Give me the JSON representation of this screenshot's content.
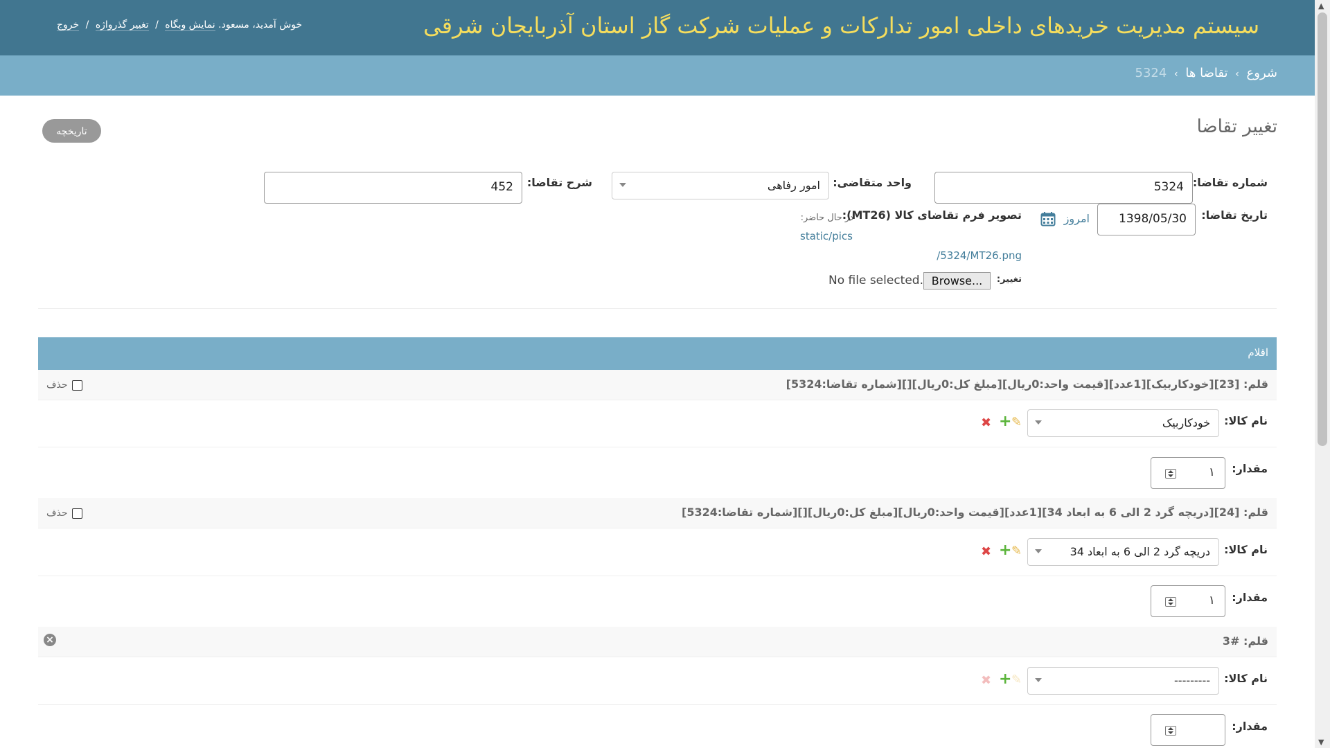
{
  "header": {
    "site_title": "سیستم مدیریت خریدهای داخلی امور تدارکات و عملیات شرکت گاز استان آذربایجان شرقی",
    "welcome": "خوش آمدید،",
    "username": "مسعود",
    "view_site": "نمایش وبگاه",
    "change_password": "تغییر گذرواژه",
    "logout": "خروج"
  },
  "breadcrumbs": {
    "home": "شروع",
    "section": "تقاضا ها",
    "current": "5324"
  },
  "page": {
    "title": "تغییر تقاضا",
    "history_button": "تاریخچه"
  },
  "form": {
    "request_number_label": "شماره تقاضا:",
    "request_number_value": "5324",
    "unit_label": "واحد متقاضی:",
    "unit_value": "امور رفاهی",
    "description_label": "شرح تقاضا:",
    "description_value": "452",
    "date_label": "تاریخ تقاضا:",
    "date_value": "1398/05/30",
    "today_link": "امروز",
    "today_sep": "|",
    "image_label": "تصویر فرم تقاضای کالا (MT26):",
    "currently_label": "در حال حاضر:",
    "current_file_part1": "static/pics",
    "current_file_part2": "/5324/MT26.png",
    "change_label": "تغییر:",
    "browse_button": "Browse...",
    "no_file": "No file selected."
  },
  "items_section": {
    "title": "اقلام",
    "delete_label": "حذف",
    "product_label": "نام کالا:",
    "quantity_label": "مقدار:",
    "rows": [
      {
        "title": "قلم: [23][خودکاربیک][1عدد][قیمت واحد:0ریال][مبلغ کل:0ریال][][شماره تقاضا:5324]",
        "product": "خودکاربیک",
        "quantity": "۱"
      },
      {
        "title": "قلم: [24][دریچه گرد 2 الی 6 به ابعاد 34][1عدد][قیمت واحد:0ریال][مبلغ کل:0ریال][][شماره تقاضا:5324]",
        "product": "دریچه گرد 2 الی 6 به ابعاد 34",
        "quantity": "۱"
      },
      {
        "title": "قلم: #3",
        "product": "---------",
        "quantity": ""
      }
    ]
  },
  "icons": {
    "edit": "pencil-icon",
    "add": "plus-icon",
    "delete": "cross-icon",
    "calendar": "calendar-icon",
    "remove_inline": "circle-x-icon"
  },
  "colors": {
    "header_bg": "#417690",
    "title_color": "#f5dd5d",
    "breadcrumb_bg": "#79aec8",
    "link": "#447e9b",
    "delete_red": "#dd4646",
    "add_green": "#5bb43b"
  }
}
